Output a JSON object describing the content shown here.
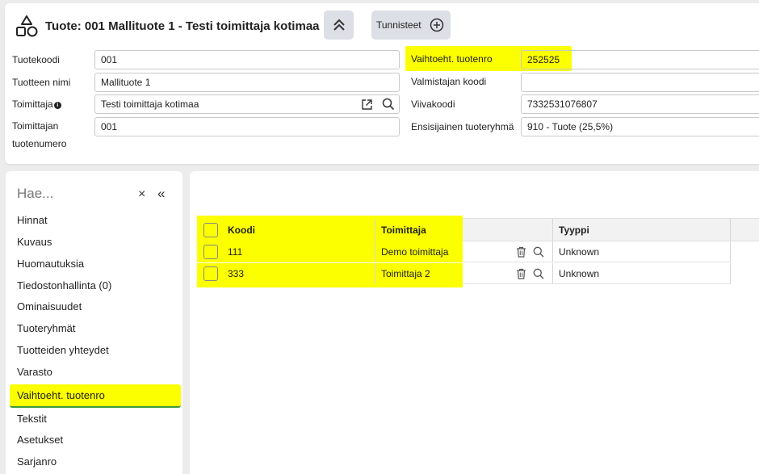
{
  "header": {
    "title": "Tuote: 001 Mallituote 1 - Testi toimittaja kotimaa",
    "tags_label": "Tunnisteet",
    "icons": [
      "shapes-icon",
      "chevron-double-up-icon",
      "plus-circle-icon",
      "external-link-icon",
      "search-icon",
      "info-icon"
    ]
  },
  "fields": {
    "tuotekoodi": {
      "label": "Tuotekoodi",
      "value": "001"
    },
    "tuotteen_nimi": {
      "label": "Tuotteen nimi",
      "value": "Mallituote 1"
    },
    "toimittaja": {
      "label": "Toimittaja",
      "value": "Testi toimittaja kotimaa"
    },
    "toimittajan_tuotenumero": {
      "label_line1": "Toimittajan",
      "label_line2": "tuotenumero",
      "value": "001"
    },
    "vaihtoeht_tuotenro": {
      "label": "Vaihtoeht. tuotenro",
      "value": "252525"
    },
    "valmistajan_koodi": {
      "label": "Valmistajan koodi",
      "value": ""
    },
    "viivakoodi": {
      "label": "Viivakoodi",
      "value": "7332531076807"
    },
    "ensisijainen_tuoteryhma": {
      "label": "Ensisijainen tuoteryhmä",
      "value": "910 - Tuote (25,5%)"
    }
  },
  "nav": {
    "search_placeholder": "Hae...",
    "clear_glyph": "×",
    "collapse_glyph": "«",
    "items": [
      {
        "label": "Hinnat"
      },
      {
        "label": "Kuvaus"
      },
      {
        "label": "Huomautuksia"
      },
      {
        "label": "Tiedostonhallinta (0)"
      },
      {
        "label": "Ominaisuudet"
      },
      {
        "label": "Tuoteryhmät"
      },
      {
        "label": "Tuotteiden yhteydet"
      },
      {
        "label": "Varasto"
      },
      {
        "label": "Vaihtoeht. tuotenro",
        "active": true
      },
      {
        "label": "Tekstit"
      },
      {
        "label": "Asetukset"
      },
      {
        "label": "Sarjanro"
      }
    ]
  },
  "grid": {
    "columns": [
      "Koodi",
      "Toimittaja",
      "Tyyppi"
    ],
    "rows": [
      {
        "koodi": "111",
        "toimittaja": "Demo toimittaja",
        "tyyppi": "Unknown"
      },
      {
        "koodi": "333",
        "toimittaja": "Toimittaja 2",
        "tyyppi": "Unknown"
      }
    ],
    "row_icons": [
      "trash-icon",
      "search-icon"
    ]
  },
  "colors": {
    "highlight": "#fbff00",
    "active_underline": "#3a9a3a",
    "button_bg": "#dcdfe6"
  }
}
